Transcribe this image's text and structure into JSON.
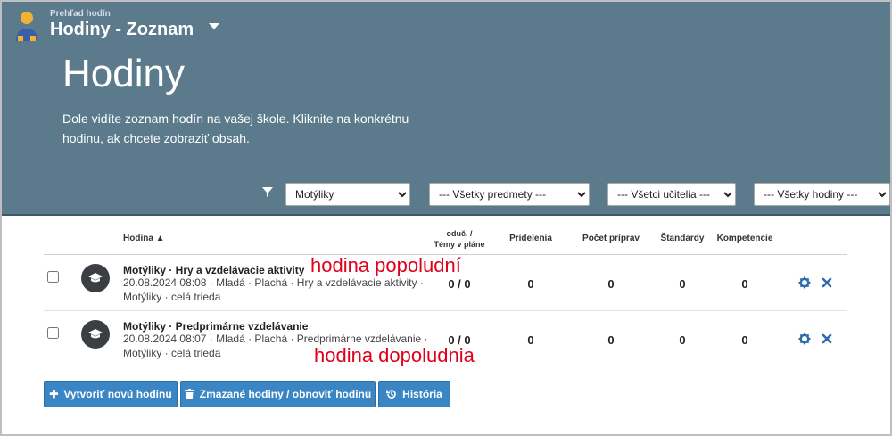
{
  "header": {
    "subtitle": "Prehľad hodín",
    "title": "Hodiny - Zoznam",
    "page_title": "Hodiny",
    "description": "Dole vidíte zoznam hodín na vašej škole. Kliknite na konkrétnu hodinu, ak chcete zobraziť obsah."
  },
  "filters": {
    "class": "Motýliky",
    "subjects": "--- Všetky predmety ---",
    "teachers": "--- Všetci učitelia ---",
    "lessons": "--- Všetky hodiny ---"
  },
  "table": {
    "columns": {
      "lesson": "Hodina ▲",
      "taught_line1": "oduč. /",
      "taught_line2": "Témy v pláne",
      "assignments": "Pridelenia",
      "preparations": "Počet príprav",
      "standards": "Štandardy",
      "competences": "Kompetencie"
    },
    "rows": [
      {
        "title": "Motýliky · Hry a vzdelávacie aktivity",
        "meta": "20.08.2024 08:08 · Mladá · Plachá · Hry a vzdelávacie aktivity · Motýliky · celá trieda",
        "taught": "0 / 0",
        "assignments": "0",
        "preparations": "0",
        "standards": "0",
        "competences": "0"
      },
      {
        "title": "Motýliky · Predprimárne vzdelávanie",
        "meta": "20.08.2024 08:07 · Mladá · Plachá · Predprimárne vzdelávanie · Motýliky · celá trieda",
        "taught": "0 / 0",
        "assignments": "0",
        "preparations": "0",
        "standards": "0",
        "competences": "0"
      }
    ]
  },
  "annotations": {
    "first": "hodina popoludní",
    "second": "hodina dopoludnia"
  },
  "buttons": {
    "create": "Vytvoriť novú hodinu",
    "deleted": "Zmazané hodiny / obnoviť hodinu",
    "history": "História"
  },
  "colors": {
    "header_bg": "#5b7a8c",
    "button_bg": "#3a86c5",
    "annotation": "#e0001b",
    "action_icon": "#2b6cb0"
  }
}
